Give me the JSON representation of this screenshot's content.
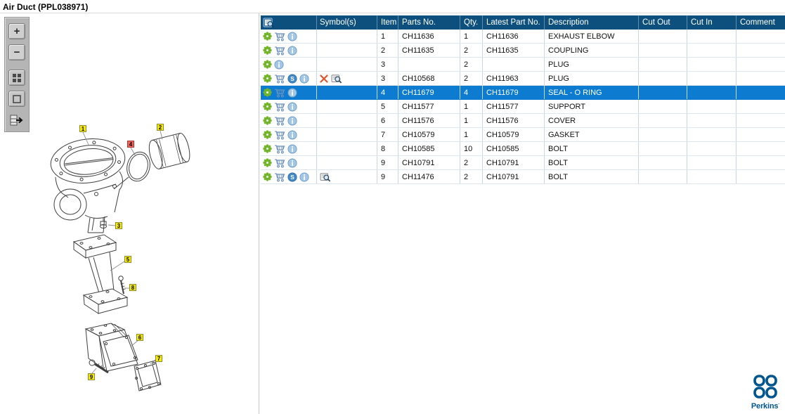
{
  "title": "Air Duct (PPL038971)",
  "toolbar": {
    "buttons": [
      {
        "name": "zoom-in",
        "glyph": "+"
      },
      {
        "name": "zoom-out",
        "glyph": "−"
      },
      {
        "name": "tile-view"
      },
      {
        "name": "frame-view"
      },
      {
        "name": "collapse-panel"
      }
    ]
  },
  "diagram": {
    "callouts": [
      {
        "label": "1",
        "highlighted": false
      },
      {
        "label": "2",
        "highlighted": false
      },
      {
        "label": "4",
        "highlighted": true
      },
      {
        "label": "3",
        "highlighted": false
      },
      {
        "label": "5",
        "highlighted": false
      },
      {
        "label": "8",
        "highlighted": false
      },
      {
        "label": "6",
        "highlighted": false
      },
      {
        "label": "7",
        "highlighted": false
      },
      {
        "label": "9",
        "highlighted": false
      }
    ]
  },
  "table": {
    "columns": [
      "",
      "Symbol(s)",
      "Item",
      "Parts No.",
      "Qty.",
      "Latest Part No.",
      "Description",
      "Cut Out",
      "Cut In",
      "Comment"
    ],
    "rows": [
      {
        "icons": [
          "gear",
          "cart",
          "info"
        ],
        "symbols": [],
        "item": "1",
        "parts_no": "CH11636",
        "qty": "1",
        "latest_part_no": "CH11636",
        "description": "EXHAUST ELBOW",
        "cut_out": "",
        "cut_in": "",
        "comment": "",
        "selected": false
      },
      {
        "icons": [
          "gear",
          "cart",
          "info"
        ],
        "symbols": [],
        "item": "2",
        "parts_no": "CH11635",
        "qty": "2",
        "latest_part_no": "CH11635",
        "description": "COUPLING",
        "cut_out": "",
        "cut_in": "",
        "comment": "",
        "selected": false
      },
      {
        "icons": [
          "gear",
          "info"
        ],
        "symbols": [],
        "item": "3",
        "parts_no": "",
        "qty": "2",
        "latest_part_no": "",
        "description": "PLUG",
        "cut_out": "",
        "cut_in": "",
        "comment": "",
        "selected": false
      },
      {
        "icons": [
          "gear",
          "cart",
          "s",
          "info"
        ],
        "symbols": [
          "x",
          "book"
        ],
        "item": "3",
        "parts_no": "CH10568",
        "qty": "2",
        "latest_part_no": "CH11963",
        "description": "PLUG",
        "cut_out": "",
        "cut_in": "",
        "comment": "",
        "selected": false
      },
      {
        "icons": [
          "gear",
          "cart",
          "info"
        ],
        "symbols": [],
        "item": "4",
        "parts_no": "CH11679",
        "qty": "4",
        "latest_part_no": "CH11679",
        "description": "SEAL - O RING",
        "cut_out": "",
        "cut_in": "",
        "comment": "",
        "selected": true
      },
      {
        "icons": [
          "gear",
          "cart",
          "info"
        ],
        "symbols": [],
        "item": "5",
        "parts_no": "CH11577",
        "qty": "1",
        "latest_part_no": "CH11577",
        "description": "SUPPORT",
        "cut_out": "",
        "cut_in": "",
        "comment": "",
        "selected": false
      },
      {
        "icons": [
          "gear",
          "cart",
          "info"
        ],
        "symbols": [],
        "item": "6",
        "parts_no": "CH11576",
        "qty": "1",
        "latest_part_no": "CH11576",
        "description": "COVER",
        "cut_out": "",
        "cut_in": "",
        "comment": "",
        "selected": false
      },
      {
        "icons": [
          "gear",
          "cart",
          "info"
        ],
        "symbols": [],
        "item": "7",
        "parts_no": "CH10579",
        "qty": "1",
        "latest_part_no": "CH10579",
        "description": "GASKET",
        "cut_out": "",
        "cut_in": "",
        "comment": "",
        "selected": false
      },
      {
        "icons": [
          "gear",
          "cart",
          "info"
        ],
        "symbols": [],
        "item": "8",
        "parts_no": "CH10585",
        "qty": "10",
        "latest_part_no": "CH10585",
        "description": "BOLT",
        "cut_out": "",
        "cut_in": "",
        "comment": "",
        "selected": false
      },
      {
        "icons": [
          "gear",
          "cart",
          "info"
        ],
        "symbols": [],
        "item": "9",
        "parts_no": "CH10791",
        "qty": "2",
        "latest_part_no": "CH10791",
        "description": "BOLT",
        "cut_out": "",
        "cut_in": "",
        "comment": "",
        "selected": false
      },
      {
        "icons": [
          "gear",
          "cart",
          "s",
          "info"
        ],
        "symbols": [
          "book"
        ],
        "item": "9",
        "parts_no": "CH11476",
        "qty": "2",
        "latest_part_no": "CH10791",
        "description": "BOLT",
        "cut_out": "",
        "cut_in": "",
        "comment": "",
        "selected": false
      }
    ]
  },
  "logo": {
    "text": "Perkins",
    "mark": "·"
  },
  "colors": {
    "header_bg": "#0d507e",
    "selected_bg": "#0c7bd0",
    "gear": "#72b529",
    "cart": "#6b91bd",
    "info": "#a3c6e4",
    "s_icon": "#4189c7",
    "x_icon": "#e2552a",
    "label_yellow": "#f8ec00",
    "label_red": "#f2635a",
    "logo_blue": "#00568e"
  }
}
